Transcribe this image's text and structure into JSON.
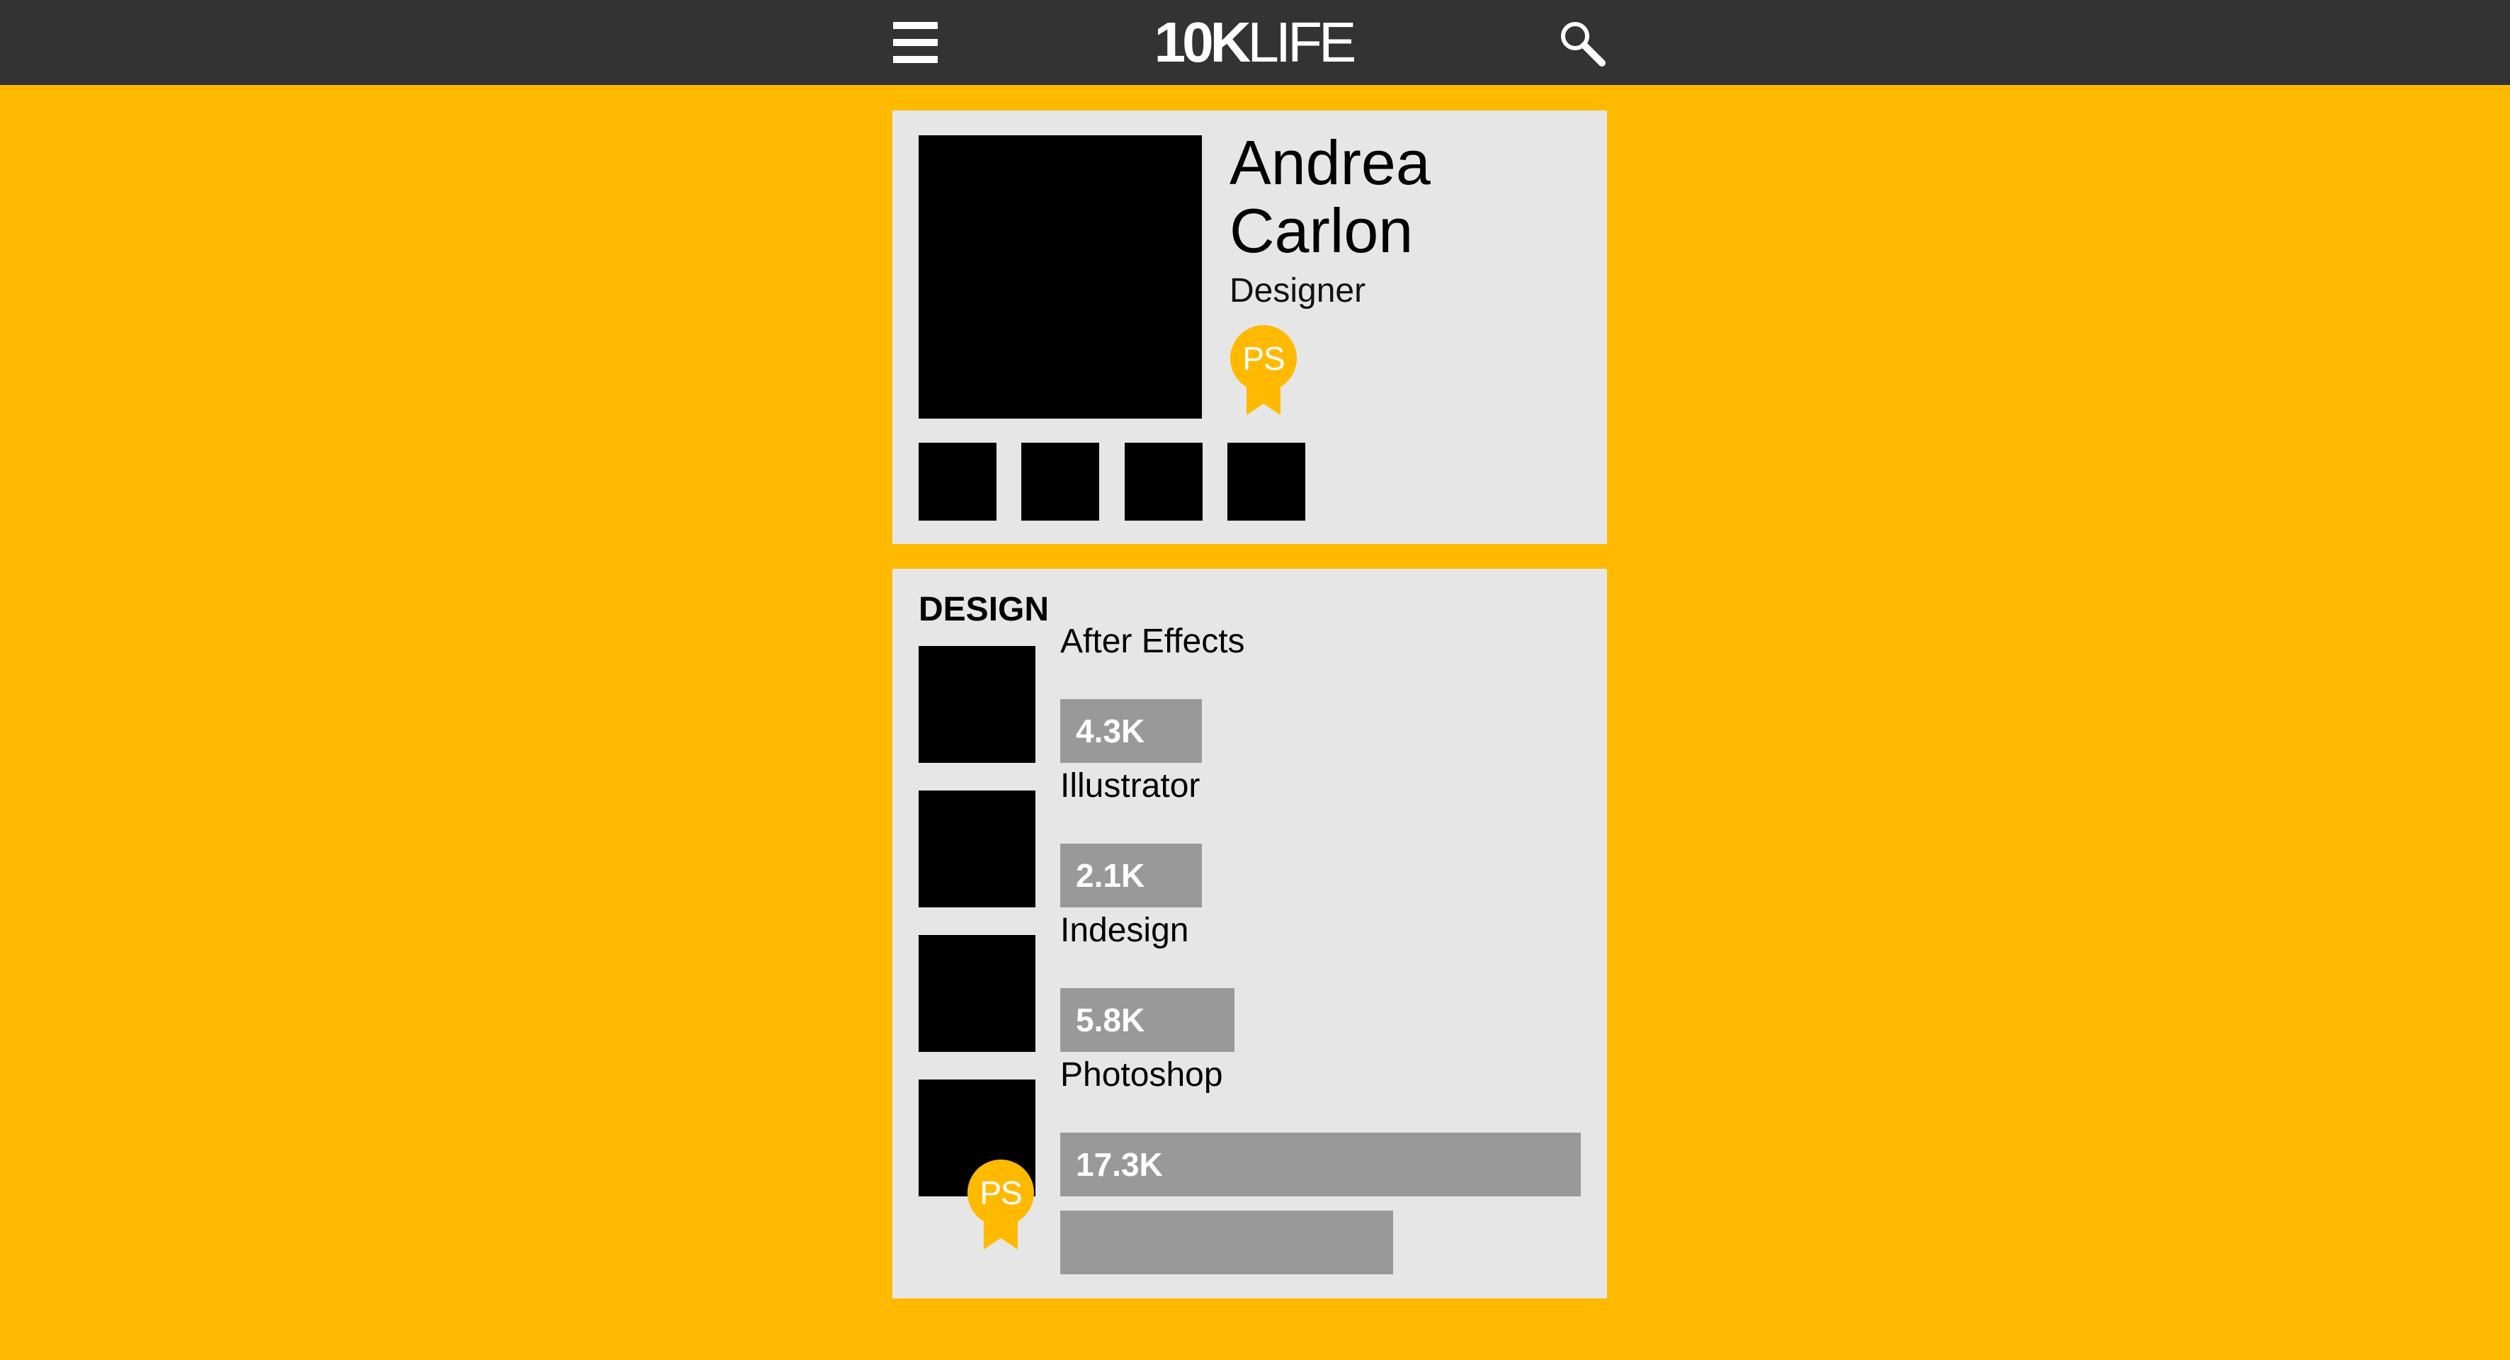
{
  "app": {
    "logo_bold": "10K",
    "logo_thin": "LIFE"
  },
  "colors": {
    "background": "#FFBA00",
    "topbar": "#333333",
    "card": "#E6E6E6",
    "bar": "#999999",
    "badge": "#FFBA00"
  },
  "icons": {
    "menu": "hamburger-menu-icon",
    "search": "magnifier-search-icon",
    "badge": "award-ribbon-icon"
  },
  "profile": {
    "first_name": "Andrea",
    "last_name": "Carlon",
    "role": "Designer",
    "badge_label": "PS"
  },
  "skills": {
    "section_title": "DESIGN",
    "items": [
      {
        "name": "After Effects",
        "value_label": "4.3K",
        "value": 4.3
      },
      {
        "name": "Illustrator",
        "value_label": "2.1K",
        "value": 2.1
      },
      {
        "name": "Indesign",
        "value_label": "5.8K",
        "value": 5.8
      },
      {
        "name": "Photoshop",
        "value_label": "17.3K",
        "value": 17.3,
        "badge_label": "PS"
      }
    ]
  }
}
